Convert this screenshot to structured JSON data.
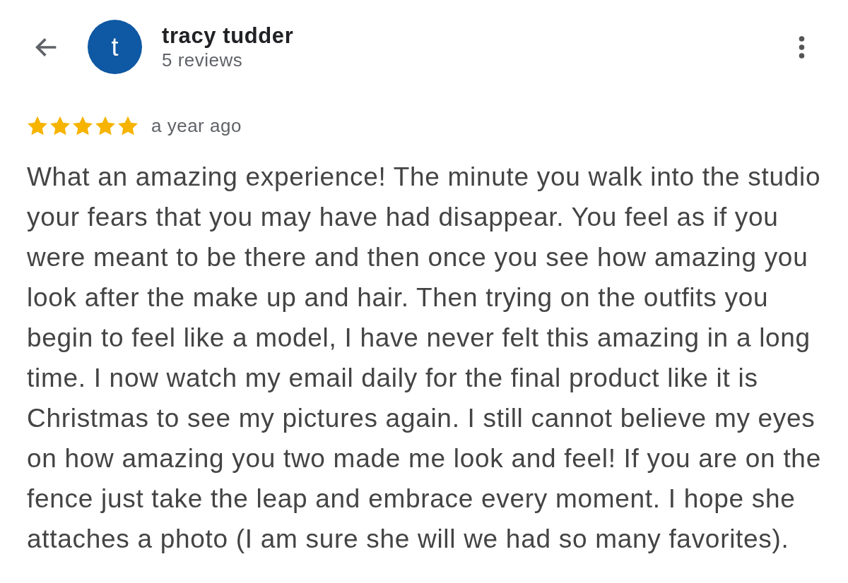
{
  "header": {
    "avatar": {
      "initial": "t",
      "color": "#0f58a3"
    },
    "name": "tracy tudder",
    "subtitle": "5 reviews"
  },
  "review": {
    "stars": 5,
    "time": "a year ago",
    "text": "What an amazing experience! The minute you walk into the studio your fears that you may have had disappear. You feel as if you were meant to be there and then once you see how amazing you look after the make up and hair. Then trying on the outfits you begin to feel like a model, I have never felt this amazing in a long time. I now watch my email daily for the final product like it is Christmas to see my pictures again. I still cannot believe my eyes on how amazing you two made me look and feel! If you are on the fence just take the leap and embrace every moment. I hope she attaches a photo (I am sure she will we had so many favorites)."
  }
}
